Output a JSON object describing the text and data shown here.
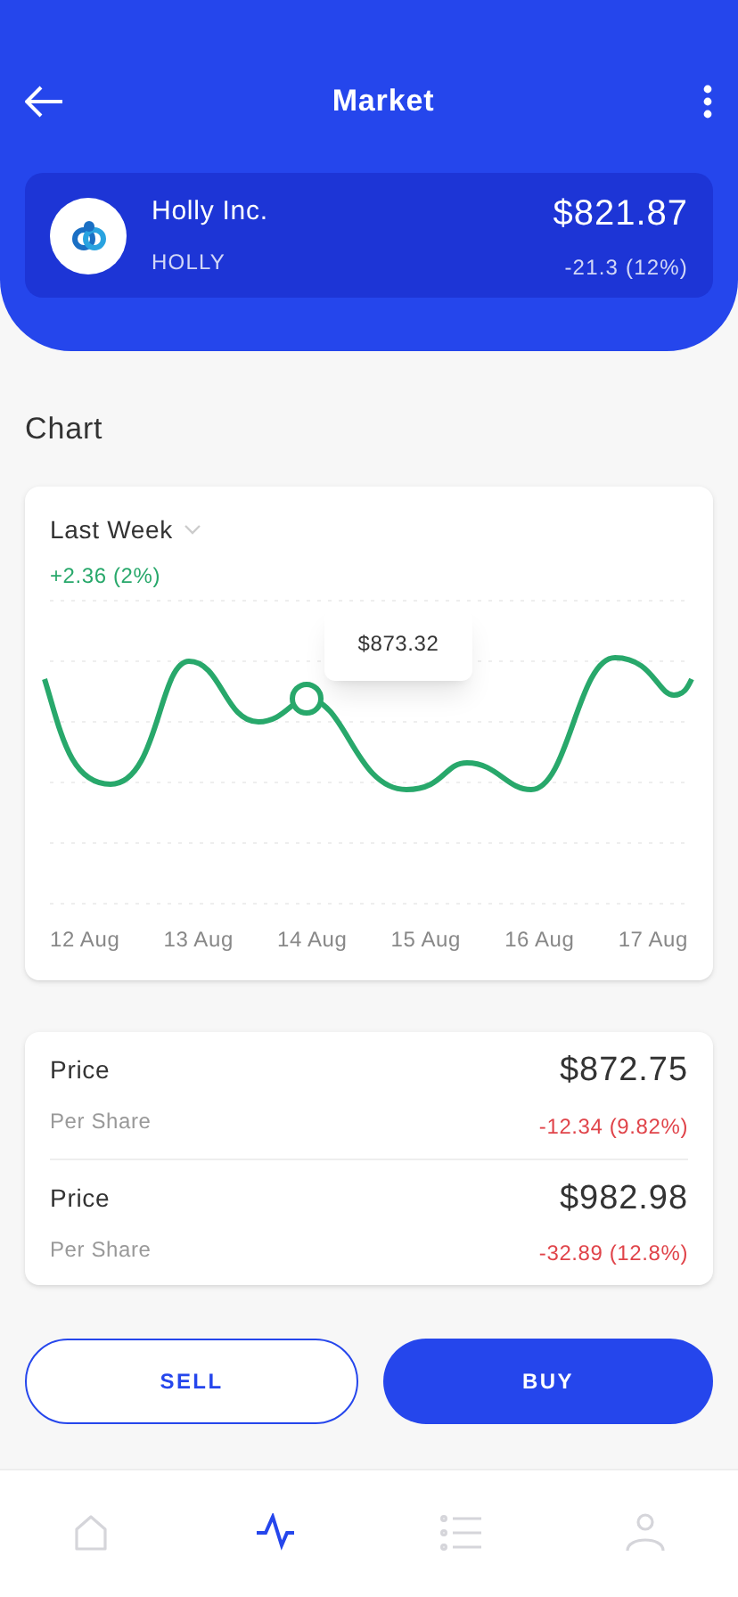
{
  "header": {
    "title": "Market"
  },
  "stock": {
    "name": "Holly Inc.",
    "ticker": "HOLLY",
    "price": "$821.87",
    "change": "-21.3 (12%)"
  },
  "section_title": "Chart",
  "chart": {
    "period": "Last Week",
    "change": "+2.36 (2%)",
    "tooltip": "$873.32",
    "x_labels": [
      "12 Aug",
      "13 Aug",
      "14 Aug",
      "15 Aug",
      "16 Aug",
      "17 Aug"
    ]
  },
  "prices": [
    {
      "label": "Price",
      "sublabel": "Per Share",
      "value": "$872.75",
      "change": "-12.34 (9.82%)"
    },
    {
      "label": "Price",
      "sublabel": "Per Share",
      "value": "$982.98",
      "change": "-32.89 (12.8%)"
    }
  ],
  "actions": [
    {
      "label": "SELL",
      "kind": "outline"
    },
    {
      "label": "BUY",
      "kind": "filled"
    }
  ],
  "nav": [
    {
      "kind": "home",
      "selected": false
    },
    {
      "kind": "activity",
      "selected": true
    },
    {
      "kind": "list",
      "selected": false
    },
    {
      "kind": "profile",
      "selected": false
    }
  ]
}
